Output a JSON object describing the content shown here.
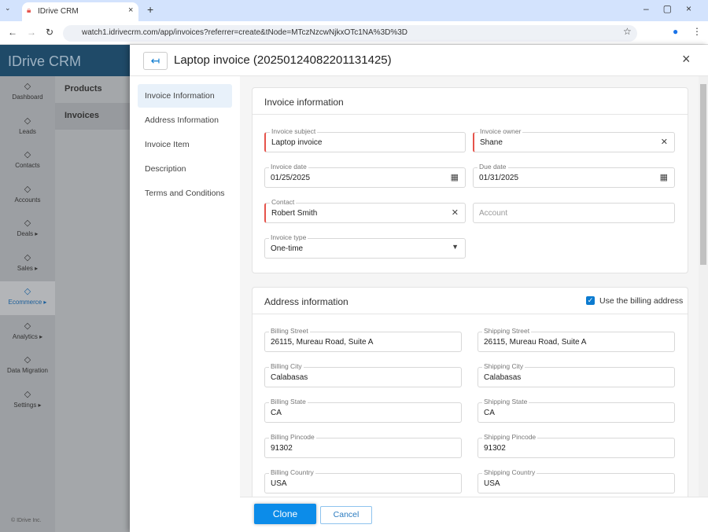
{
  "browser": {
    "tab_title": "IDrive CRM",
    "url": "watch1.idrivecrm.com/app/invoices?referrer=create&tNode=MTczNzcwNjkxOTc1NA%3D%3D"
  },
  "app": {
    "logo": "IDrive CRM",
    "brand_color": "#0e4a72",
    "accent": "#0c8ce9"
  },
  "sidebar": {
    "items": [
      {
        "label": "Dashboard",
        "icon": "dashboard-icon"
      },
      {
        "label": "Leads",
        "icon": "leads-icon"
      },
      {
        "label": "Contacts",
        "icon": "contacts-icon"
      },
      {
        "label": "Accounts",
        "icon": "accounts-icon"
      },
      {
        "label": "Deals ▸",
        "icon": "deals-icon"
      },
      {
        "label": "Sales ▸",
        "icon": "sales-icon"
      },
      {
        "label": "Ecommerce ▸",
        "icon": "ecommerce-icon",
        "active": true
      },
      {
        "label": "Analytics ▸",
        "icon": "analytics-icon"
      },
      {
        "label": "Data Migration",
        "icon": "data-migration-icon"
      },
      {
        "label": "Settings ▸",
        "icon": "settings-icon"
      }
    ],
    "copyright": "© IDrive Inc."
  },
  "subnav": [
    "Products",
    "Invoices"
  ],
  "modal": {
    "title": "Laptop invoice (20250124082201131425)",
    "nav": [
      "Invoice Information",
      "Address Information",
      "Invoice Item",
      "Description",
      "Terms and Conditions"
    ],
    "invoice_section": {
      "title": "Invoice information",
      "subject": {
        "label": "Invoice subject",
        "value": "Laptop invoice"
      },
      "owner": {
        "label": "Invoice owner",
        "value": "Shane"
      },
      "invoice_date": {
        "label": "Invoice date",
        "value": "01/25/2025"
      },
      "due_date": {
        "label": "Due date",
        "value": "01/31/2025"
      },
      "contact": {
        "label": "Contact",
        "value": "Robert Smith"
      },
      "account": {
        "placeholder": "Account"
      },
      "type": {
        "label": "Invoice type",
        "value": "One-time"
      }
    },
    "address_section": {
      "title": "Address information",
      "use_billing": "Use the billing address",
      "use_billing_checked": true,
      "billing": [
        {
          "label": "Billing Street",
          "value": "26115, Mureau Road, Suite A"
        },
        {
          "label": "Billing City",
          "value": "Calabasas"
        },
        {
          "label": "Billing State",
          "value": "CA"
        },
        {
          "label": "Billing Pincode",
          "value": "91302"
        },
        {
          "label": "Billing Country",
          "value": "USA"
        }
      ],
      "shipping": [
        {
          "label": "Shipping Street",
          "value": "26115, Mureau Road, Suite A"
        },
        {
          "label": "Shipping City",
          "value": "Calabasas"
        },
        {
          "label": "Shipping State",
          "value": "CA"
        },
        {
          "label": "Shipping Pincode",
          "value": "91302"
        },
        {
          "label": "Shipping Country",
          "value": "USA"
        }
      ]
    },
    "clone_label": "Clone",
    "cancel_label": "Cancel"
  }
}
